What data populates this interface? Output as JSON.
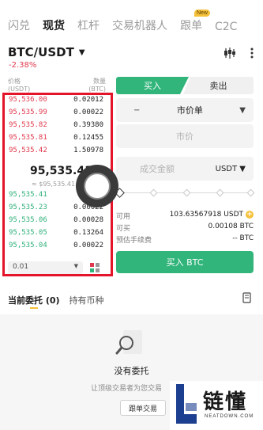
{
  "top_tabs": [
    {
      "label": "闪兑",
      "active": false
    },
    {
      "label": "现货",
      "active": true
    },
    {
      "label": "杠杆",
      "active": false
    },
    {
      "label": "交易机器人",
      "active": false
    },
    {
      "label": "跟单",
      "active": false,
      "badge": "New"
    },
    {
      "label": "C2C",
      "active": false
    }
  ],
  "pair": {
    "symbol": "BTC/USDT",
    "caret": "▼",
    "change": "-2.38%"
  },
  "header_icons": [
    "candlestick-settings-icon",
    "more-icon"
  ],
  "order_book": {
    "price_header": "价格\n(USDT)",
    "qty_header": "数量\n(BTC)",
    "asks": [
      {
        "price": "95,536.00",
        "qty": "0.02012"
      },
      {
        "price": "95,535.99",
        "qty": "0.00022"
      },
      {
        "price": "95,535.82",
        "qty": "0.39380"
      },
      {
        "price": "95,535.81",
        "qty": "0.12455"
      },
      {
        "price": "95,535.42",
        "qty": "1.50978"
      }
    ],
    "last_price": "95,535.41",
    "last_fiat": "≈ $95,535.41",
    "bids": [
      {
        "price": "95,535.41",
        "qty": "1."
      },
      {
        "price": "95,535.23",
        "qty": "0.00022"
      },
      {
        "price": "95,535.06",
        "qty": "0.00028"
      },
      {
        "price": "95,535.05",
        "qty": "0.13264"
      },
      {
        "price": "95,535.04",
        "qty": "0.00022"
      }
    ],
    "precision": "0.01",
    "precision_caret": "▼"
  },
  "trade": {
    "buy_tab": "买入",
    "sell_tab": "卖出",
    "order_type": "市价单",
    "order_type_minus": "−",
    "order_type_caret": "▼",
    "price_placeholder": "市价",
    "amount_placeholder": "成交金额",
    "amount_unit": "USDT ▼",
    "available_label": "可用",
    "available_value": "103.63567918 USDT",
    "can_buy_label": "可买",
    "can_buy_value": "0.00108 BTC",
    "fee_label": "预估手续费",
    "fee_value": "-- BTC",
    "buy_button": "买入 BTC"
  },
  "bottom": {
    "tab_orders": "当前委托 (0)",
    "tab_holdings": "持有币种",
    "empty_title": "没有委托",
    "empty_sub": "让顶级交易者为您交易",
    "copy_button": "跟单交易"
  },
  "watermark": {
    "text": "链懂",
    "sub": "NEATDOWN.COM"
  },
  "colors": {
    "green": "#31b57b",
    "red": "#e0384c",
    "accent": "#f5c13a",
    "frame": "#e4142b"
  }
}
